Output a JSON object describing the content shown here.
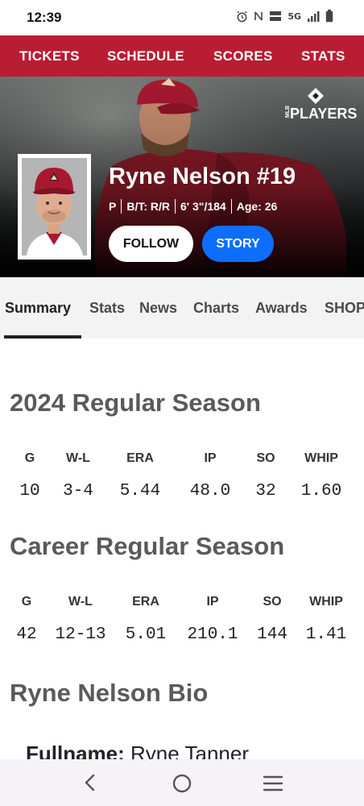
{
  "status_bar": {
    "time": "12:39",
    "network": "5G",
    "icons": [
      "alarm-icon",
      "nfc-icon",
      "volte-icon",
      "signal-icon",
      "battery-icon"
    ]
  },
  "top_nav": {
    "items": [
      "TICKETS",
      "SCHEDULE",
      "SCORES",
      "STATS"
    ]
  },
  "hero": {
    "brand_logo_text": "PLAYERS",
    "brand_logo_small": "MLB",
    "name": "Ryne Nelson #19",
    "position": "P",
    "bats_throws": "B/T: R/R",
    "height_weight": "6' 3\"/184",
    "age": "Age: 26",
    "follow_label": "FOLLOW",
    "story_label": "STORY"
  },
  "tabs": [
    "Summary",
    "Stats",
    "News",
    "Charts",
    "Awards",
    "SHOP"
  ],
  "active_tab": "Summary",
  "season": {
    "title": "2024 Regular Season",
    "headers": [
      "G",
      "W-L",
      "ERA",
      "IP",
      "SO",
      "WHIP"
    ],
    "values": [
      "10",
      "3-4",
      "5.44",
      "48.0",
      "32",
      "1.60"
    ]
  },
  "career": {
    "title": "Career Regular Season",
    "headers": [
      "G",
      "W-L",
      "ERA",
      "IP",
      "SO",
      "WHIP"
    ],
    "values": [
      "42",
      "12-13",
      "5.01",
      "210.1",
      "144",
      "1.41"
    ]
  },
  "bio": {
    "title": "Ryne Nelson Bio",
    "fullname_label": "Fullname:",
    "fullname_value": "Ryne Tanner"
  },
  "colors": {
    "nav_red": "#b81d33",
    "story_blue": "#0d6efd",
    "dbacks_red": "#a71930"
  }
}
